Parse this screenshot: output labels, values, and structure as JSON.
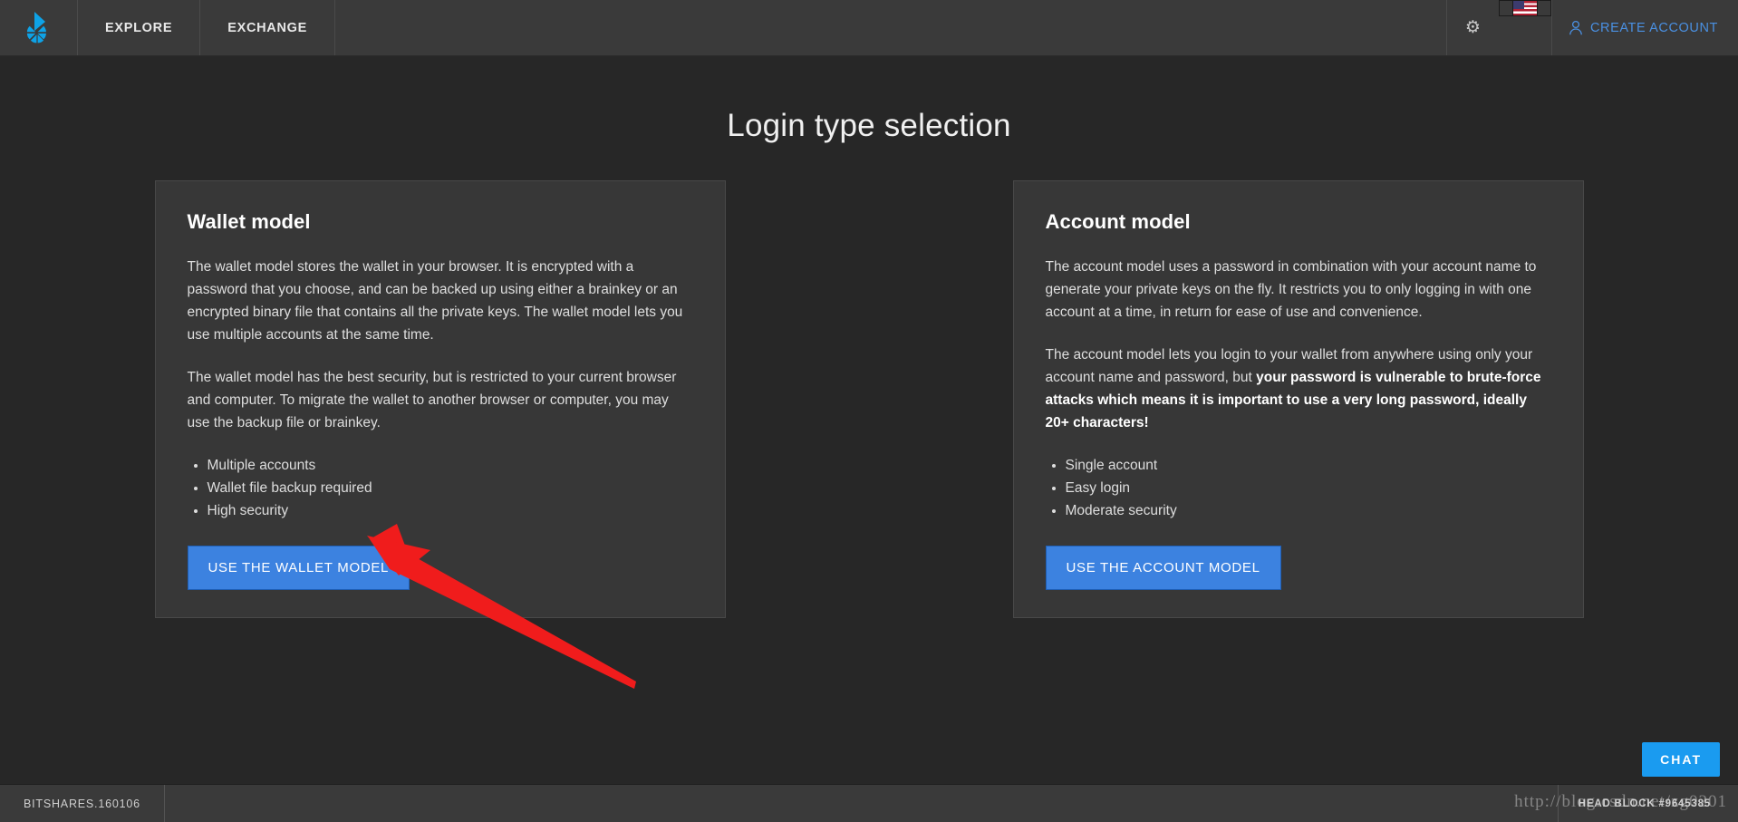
{
  "header": {
    "logo_icon": "bitshares-logo-icon",
    "nav": [
      {
        "label": "EXPLORE"
      },
      {
        "label": "EXCHANGE"
      }
    ],
    "settings_icon": "gear-icon",
    "language_flag": "us-flag-icon",
    "create_account": {
      "icon": "person-icon",
      "label": "CREATE ACCOUNT"
    }
  },
  "main": {
    "title": "Login type selection",
    "cards": [
      {
        "heading": "Wallet model",
        "paragraphs": [
          "The wallet model stores the wallet in your browser. It is encrypted with a password that you choose, and can be backed up using either a brainkey or an encrypted binary file that contains all the private keys. The wallet model lets you use multiple accounts at the same time.",
          "The wallet model has the best security, but is restricted to your current browser and computer. To migrate the wallet to another browser or computer, you may use the backup file or brainkey."
        ],
        "bullets": [
          "Multiple accounts",
          "Wallet file backup required",
          "High security"
        ],
        "button_label": "USE THE WALLET MODEL"
      },
      {
        "heading": "Account model",
        "paragraphs": [
          "The account model uses a password in combination with your account name to generate your private keys on the fly. It restricts you to only logging in with one account at a time, in return for ease of use and convenience."
        ],
        "paragraph_mixed": {
          "plain_before": "The account model lets you login to your wallet from anywhere using only your account name and password, but ",
          "bold": "your password is vulnerable to brute-force attacks which means it is important to use a very long password, ideally 20+ characters!"
        },
        "bullets": [
          "Single account",
          "Easy login",
          "Moderate security"
        ],
        "button_label": "USE THE ACCOUNT MODEL"
      }
    ]
  },
  "chat": {
    "label": "CHAT"
  },
  "footer": {
    "version": "BITSHARES.160106",
    "head_block": "HEAD BLOCK #9645385"
  },
  "watermark": {
    "text": "http://blog.csdn.net/zg0201"
  },
  "annotation": {
    "arrow_icon": "red-arrow-annotation"
  },
  "colors": {
    "accent_blue": "#3c82e0",
    "link_blue": "#4a90e2",
    "chat_blue": "#1a9bf0",
    "logo_blue": "#0ea2e6",
    "page_bg": "#272727",
    "card_bg": "#373737",
    "header_bg": "#3a3a3a",
    "annotation_red": "#f01c1c"
  }
}
